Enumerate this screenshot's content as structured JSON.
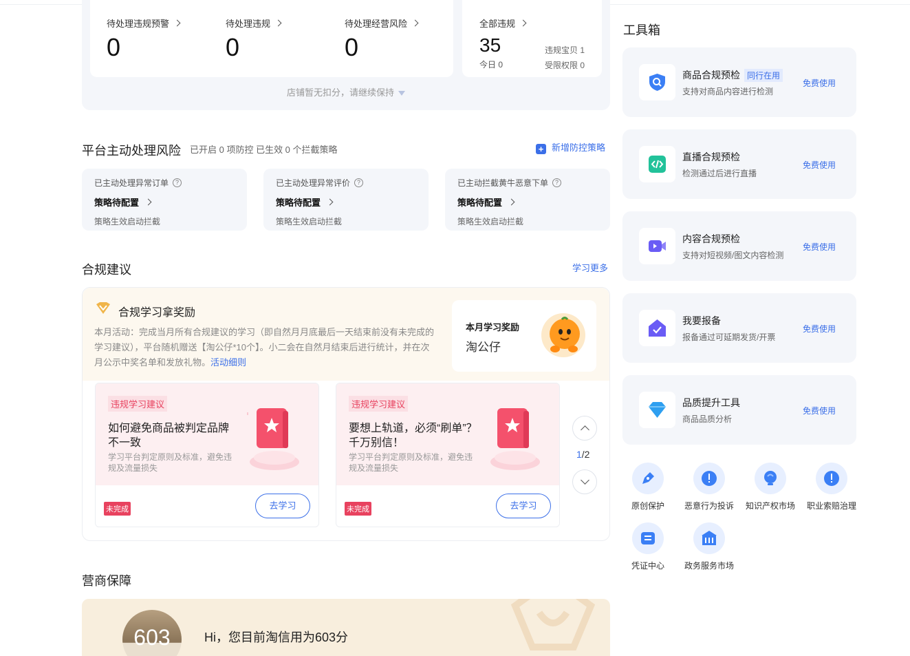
{
  "stats": {
    "pending_warning": {
      "label": "待处理违规预警",
      "value": "0"
    },
    "pending_violation": {
      "label": "待处理违规",
      "value": "0"
    },
    "pending_risk": {
      "label": "待处理经营风险",
      "value": "0"
    },
    "all_violations": {
      "label": "全部违规",
      "value": "35",
      "today": "今日 0",
      "items": "违规宝贝 1",
      "restrictions": "受限权限 0"
    },
    "hint": "店铺暂无扣分，请继续保持"
  },
  "risk": {
    "title": "平台主动处理风险",
    "subtitle": "已开启 0 项防控 已生效 0 个拦截策略",
    "add_link": "新增防控策略",
    "cards": [
      {
        "title": "已主动处理异常订单",
        "status": "策略待配置",
        "desc": "策略生效启动拦截"
      },
      {
        "title": "已主动处理异常评价",
        "status": "策略待配置",
        "desc": "策略生效启动拦截"
      },
      {
        "title": "已主动拦截黄牛恶意下单",
        "status": "策略待配置",
        "desc": "策略生效启动拦截"
      }
    ]
  },
  "compliance": {
    "title": "合规建议",
    "more_link": "学习更多",
    "reward_title": "合规学习拿奖励",
    "reward_desc": "本月活动：完成当月所有合规建议的学习（即自然月月底最后一天结束前没有未完成的学习建议），平台随机赠送【淘公仔*10个】。小二会在自然月结束后进行统计，并在次月公示中奖名单和发放礼物。",
    "reward_link": "活动细则",
    "month_reward_title": "本月学习奖励",
    "month_reward_value": "淘公仔",
    "cards": [
      {
        "tag": "违规学习建议",
        "title": "如何避免商品被判定品牌不一致",
        "desc": "学习平台判定原则及标准，避免违规及流量损失",
        "status": "未完成",
        "button": "去学习"
      },
      {
        "tag": "违规学习建议",
        "title": "要想上轨道，必须“刷单”？千万别信！",
        "desc": "学习平台判定原则及标准，避免违规及流量损失",
        "status": "未完成",
        "button": "去学习"
      }
    ],
    "pager": {
      "current": "1",
      "total": "/2"
    }
  },
  "guarantee": {
    "title": "营商保障",
    "score": "603",
    "text": "Hi，您目前淘信用为603分"
  },
  "toolbox": {
    "title": "工具箱",
    "tools": [
      {
        "name": "商品合规预检",
        "badge": "同行在用",
        "desc": "支持对商品内容进行检测",
        "action": "免费使用",
        "icon": "shield-search-icon"
      },
      {
        "name": "直播合规预检",
        "badge": "",
        "desc": "检测通过后进行直播",
        "action": "免费使用",
        "icon": "code-icon"
      },
      {
        "name": "内容合规预检",
        "badge": "",
        "desc": "支持对短视频/图文内容检测",
        "action": "免费使用",
        "icon": "video-icon"
      },
      {
        "name": "我要报备",
        "badge": "",
        "desc": "报备通过可延期发货/开票",
        "action": "免费使用",
        "icon": "house-check-icon"
      },
      {
        "name": "品质提升工具",
        "badge": "",
        "desc": "商品品质分析",
        "action": "免费使用",
        "icon": "diamond-icon"
      }
    ],
    "services": [
      {
        "label": "原创保护",
        "icon": "pen-shield-icon"
      },
      {
        "label": "恶意行为投诉",
        "icon": "alert-chat-icon"
      },
      {
        "label": "知识产权市场",
        "icon": "bulb-icon"
      },
      {
        "label": "职业索赔治理",
        "icon": "alert-chat-icon"
      },
      {
        "label": "凭证中心",
        "icon": "voucher-icon"
      },
      {
        "label": "政务服务市场",
        "icon": "government-icon"
      }
    ]
  },
  "colors": {
    "accent": "#3b6fe8",
    "danger": "#e8425f",
    "panel": "#f4f6fa"
  }
}
